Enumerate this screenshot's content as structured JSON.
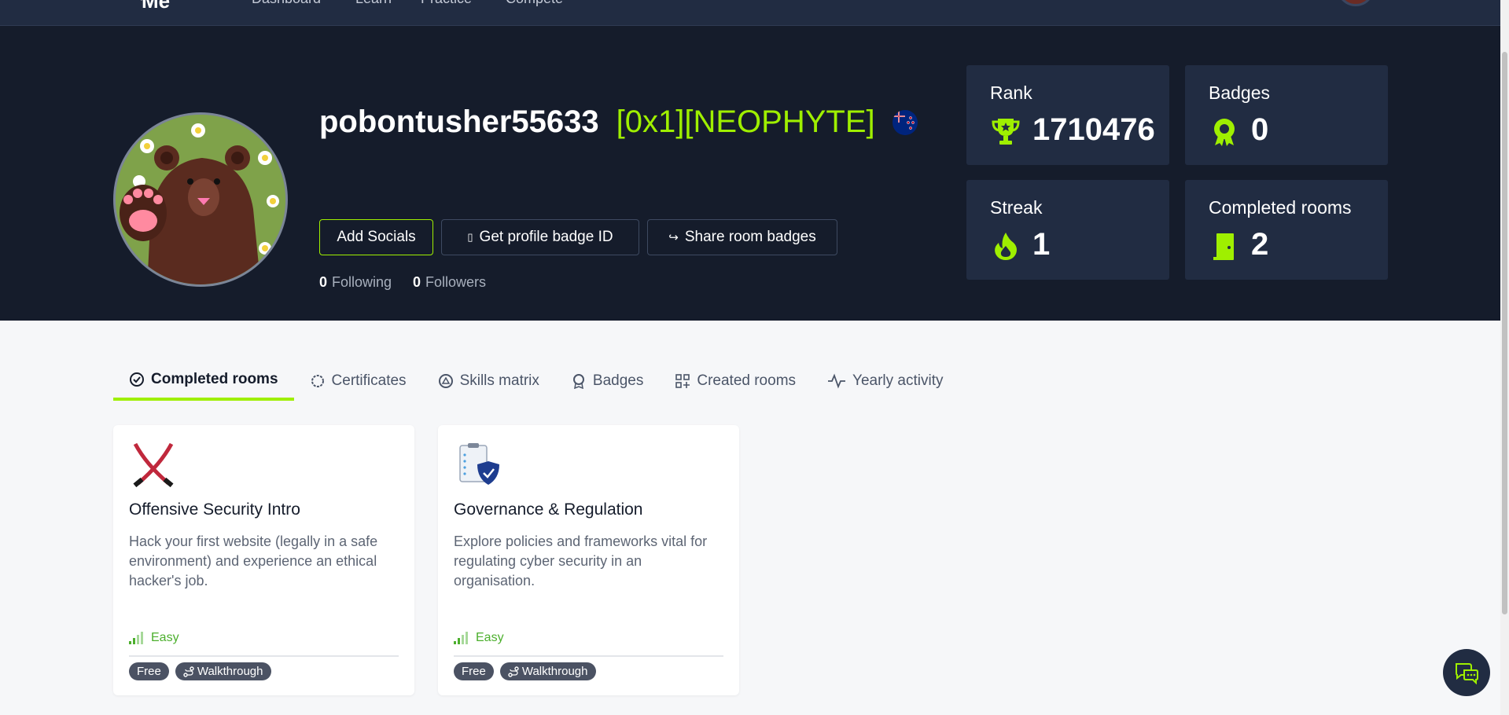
{
  "topnav": {
    "logo": "Me",
    "links": [
      "Dashboard",
      "Learn",
      "Practice",
      "Compete"
    ]
  },
  "profile": {
    "username": "pobontusher55633",
    "level": "[0x1][NEOPHYTE]",
    "flag_icon": "new-zealand-flag-icon",
    "buttons": {
      "add_socials": "Add Socials",
      "badge_id": "Get profile badge ID",
      "share": "Share room badges"
    },
    "following_count": "0",
    "following_label": "Following",
    "followers_count": "0",
    "followers_label": "Followers"
  },
  "stats": {
    "rank": {
      "label": "Rank",
      "value": "1710476",
      "icon": "trophy-icon"
    },
    "badges": {
      "label": "Badges",
      "value": "0",
      "icon": "badge-icon"
    },
    "streak": {
      "label": "Streak",
      "value": "1",
      "icon": "flame-icon"
    },
    "completed": {
      "label": "Completed rooms",
      "value": "2",
      "icon": "door-icon"
    }
  },
  "tabs": [
    {
      "label": "Completed rooms",
      "icon": "check-circle-icon"
    },
    {
      "label": "Certificates",
      "icon": "certificate-icon"
    },
    {
      "label": "Skills matrix",
      "icon": "skills-icon"
    },
    {
      "label": "Badges",
      "icon": "badge-outline-icon"
    },
    {
      "label": "Created rooms",
      "icon": "grid-plus-icon"
    },
    {
      "label": "Yearly activity",
      "icon": "activity-icon"
    }
  ],
  "rooms": [
    {
      "title": "Offensive Security Intro",
      "description": "Hack your first website (legally in a safe environment) and experience an ethical hacker's job.",
      "difficulty": "Easy",
      "tags": [
        "Free",
        "Walkthrough"
      ]
    },
    {
      "title": "Governance & Regulation",
      "description": "Explore policies and frameworks vital for regulating cyber security in an organisation.",
      "difficulty": "Easy",
      "tags": [
        "Free",
        "Walkthrough"
      ]
    }
  ],
  "colors": {
    "accent": "#9fef00",
    "hero_bg": "#151c2b",
    "card_bg": "#212c42"
  }
}
